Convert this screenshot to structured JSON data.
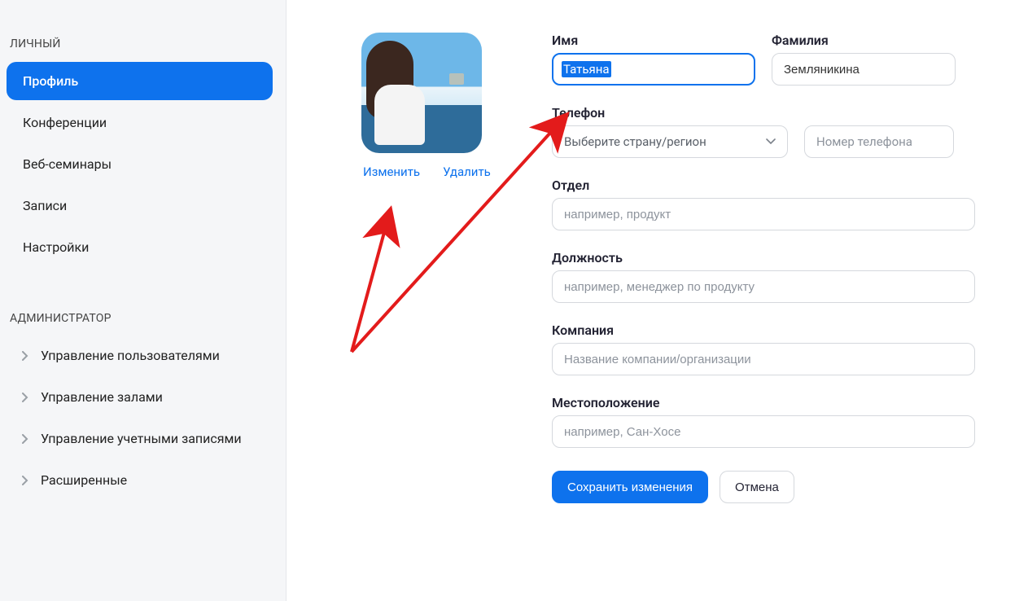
{
  "sidebar": {
    "personal_label": "ЛИЧНЫЙ",
    "admin_label": "АДМИНИСТРАТОР",
    "personal_items": [
      {
        "label": "Профиль",
        "active": true
      },
      {
        "label": "Конференции"
      },
      {
        "label": "Веб-семинары"
      },
      {
        "label": "Записи"
      },
      {
        "label": "Настройки"
      }
    ],
    "admin_items": [
      {
        "label": "Управление пользователями"
      },
      {
        "label": "Управление залами"
      },
      {
        "label": "Управление учетными записями"
      },
      {
        "label": "Расширенные"
      }
    ]
  },
  "avatar": {
    "change_label": "Изменить",
    "delete_label": "Удалить"
  },
  "form": {
    "first_name_label": "Имя",
    "first_name_value": "Татьяна",
    "last_name_label": "Фамилия",
    "last_name_value": "Земляникина",
    "phone_label": "Телефон",
    "phone_country_placeholder": "Выберите страну/регион",
    "phone_number_placeholder": "Номер телефона",
    "department_label": "Отдел",
    "department_placeholder": "например, продукт",
    "job_title_label": "Должность",
    "job_title_placeholder": "например, менеджер по продукту",
    "company_label": "Компания",
    "company_placeholder": "Название компании/организации",
    "location_label": "Местоположение",
    "location_placeholder": "например, Сан-Хосе",
    "save_label": "Сохранить изменения",
    "cancel_label": "Отмена"
  }
}
